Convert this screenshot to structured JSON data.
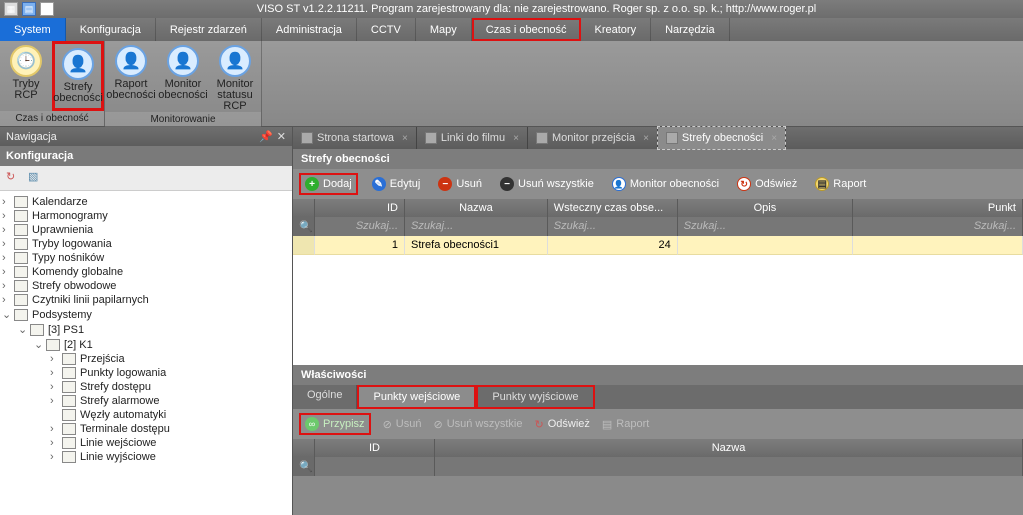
{
  "titlebar": {
    "title": "VISO ST v1.2.2.11211. Program zarejestrowany dla: nie zarejestrowano. Roger sp. z o.o. sp. k.; http://www.roger.pl"
  },
  "menu": {
    "items": [
      "System",
      "Konfiguracja",
      "Rejestr zdarzeń",
      "Administracja",
      "CCTV",
      "Mapy",
      "Czas i obecność",
      "Kreatory",
      "Narzędzia"
    ],
    "active_index": 0,
    "highlight_index": 6
  },
  "ribbon": {
    "groups": [
      {
        "title": "Czas i obecność",
        "buttons": [
          {
            "label_top": "Tryby",
            "label_bot": "RCP",
            "icon": "clock"
          },
          {
            "label_top": "Strefy",
            "label_bot": "obecności",
            "icon": "user",
            "highlight": true
          }
        ]
      },
      {
        "title": "Monitorowanie",
        "buttons": [
          {
            "label_top": "Raport",
            "label_bot": "obecności",
            "icon": "user-doc"
          },
          {
            "label_top": "Monitor",
            "label_bot": "obecności",
            "icon": "user-eye"
          },
          {
            "label_top": "Monitor",
            "label_bot": "statusu RCP",
            "icon": "user-clock"
          }
        ]
      }
    ]
  },
  "nav": {
    "panel_title": "Nawigacja",
    "section_title": "Konfiguracja",
    "tree": [
      {
        "label": "Kalendarze"
      },
      {
        "label": "Harmonogramy"
      },
      {
        "label": "Uprawnienia"
      },
      {
        "label": "Tryby logowania"
      },
      {
        "label": "Typy nośników"
      },
      {
        "label": "Komendy globalne"
      },
      {
        "label": "Strefy obwodowe"
      },
      {
        "label": "Czytniki linii papilarnych"
      },
      {
        "label": "Podsystemy",
        "open": true,
        "children": [
          {
            "label": "[3] PS1",
            "open": true,
            "children": [
              {
                "label": "[2] K1",
                "open": true,
                "children": [
                  {
                    "label": "Przejścia"
                  },
                  {
                    "label": "Punkty logowania"
                  },
                  {
                    "label": "Strefy dostępu"
                  },
                  {
                    "label": "Strefy alarmowe"
                  },
                  {
                    "label": "Węzły automatyki",
                    "leaf": true
                  },
                  {
                    "label": "Terminale dostępu"
                  },
                  {
                    "label": "Linie wejściowe"
                  },
                  {
                    "label": "Linie wyjściowe"
                  }
                ]
              }
            ]
          }
        ]
      }
    ]
  },
  "doctabs": {
    "items": [
      {
        "label": "Strona startowa"
      },
      {
        "label": "Linki do filmu"
      },
      {
        "label": "Monitor przejścia"
      },
      {
        "label": "Strefy obecności",
        "active": true
      }
    ]
  },
  "zone_panel": {
    "title": "Strefy obecności",
    "toolbar": {
      "add": "Dodaj",
      "edit": "Edytuj",
      "del": "Usuń",
      "del_all": "Usuń wszystkie",
      "monitor": "Monitor obecności",
      "refresh": "Odśwież",
      "report": "Raport"
    },
    "columns": {
      "id": "ID",
      "name": "Nazwa",
      "back": "Wsteczny czas obse...",
      "desc": "Opis",
      "punkt": "Punkt",
      "search": "Szukaj..."
    },
    "row": {
      "id": "1",
      "name": "Strefa obecności1",
      "back": "24",
      "desc": "",
      "punkt": ""
    }
  },
  "props": {
    "title": "Właściwości",
    "tabs": {
      "general": "Ogólne",
      "in": "Punkty wejściowe",
      "out": "Punkty wyjściowe"
    },
    "active_tab": 1,
    "toolbar": {
      "assign": "Przypisz",
      "del": "Usuń",
      "del_all": "Usuń wszystkie",
      "refresh": "Odśwież",
      "report": "Raport"
    },
    "columns": {
      "id": "ID",
      "name": "Nazwa"
    }
  }
}
